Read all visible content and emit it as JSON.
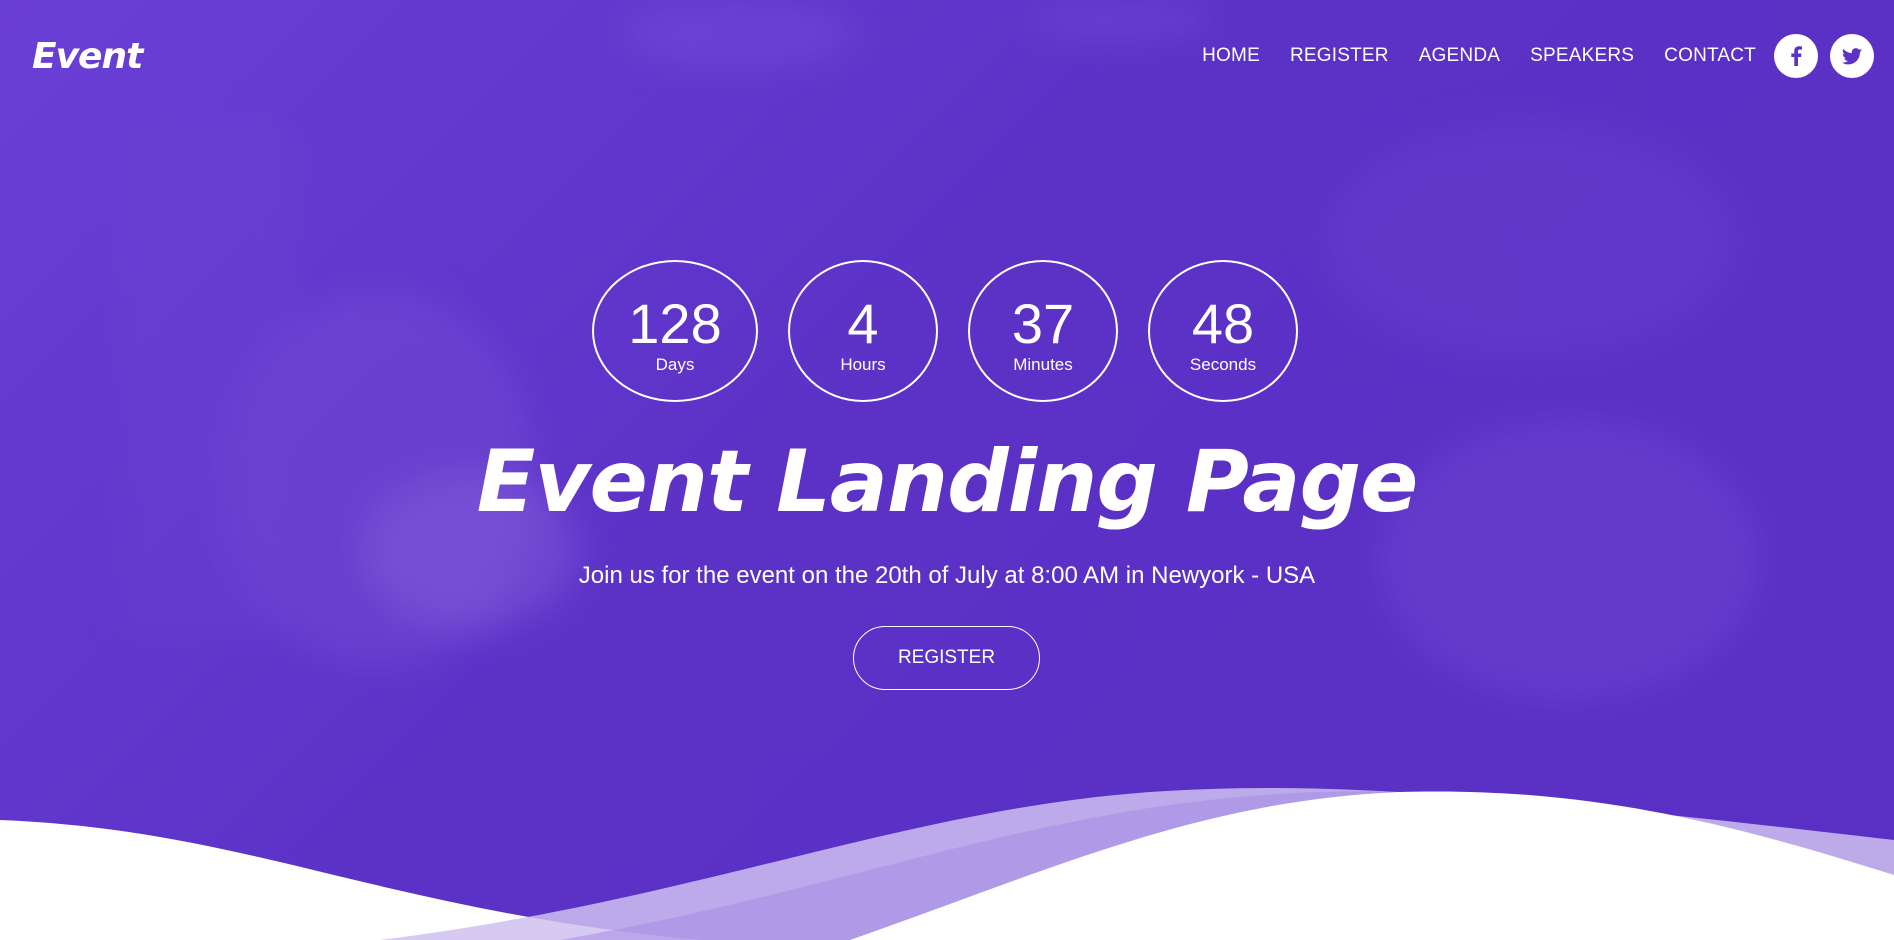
{
  "header": {
    "logo": "Event",
    "nav": [
      {
        "label": "HOME"
      },
      {
        "label": "REGISTER"
      },
      {
        "label": "AGENDA"
      },
      {
        "label": "SPEAKERS"
      },
      {
        "label": "CONTACT"
      }
    ],
    "social": [
      {
        "icon": "facebook-icon",
        "glyph": "f"
      },
      {
        "icon": "twitter-icon",
        "glyph": "bird"
      }
    ]
  },
  "countdown": [
    {
      "value": "128",
      "label": "Days"
    },
    {
      "value": "4",
      "label": "Hours"
    },
    {
      "value": "37",
      "label": "Minutes"
    },
    {
      "value": "48",
      "label": "Seconds"
    }
  ],
  "hero": {
    "title": "Event Landing Page",
    "subtitle": "Join us for the event on the 20th of July at 8:00 AM in Newyork - USA",
    "cta": "REGISTER"
  },
  "colors": {
    "primary": "#5b31c6",
    "primary_light": "#6a3fd6",
    "text": "#ffffff",
    "wave_light": "#cfc0f0",
    "wave_mid": "#a58be3",
    "social_icon": "#5b31c6"
  }
}
